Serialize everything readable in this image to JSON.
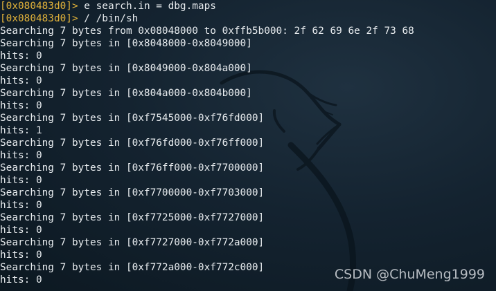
{
  "terminal": {
    "colors": {
      "background": "#142330",
      "text": "#e8ecef",
      "prompt": "#e2b33a"
    },
    "commands": [
      {
        "prompt": "[0x080483d0]>",
        "text": " e search.in = dbg.maps"
      },
      {
        "prompt": "[0x080483d0]>",
        "text": " / /bin/sh"
      }
    ],
    "output": [
      "Searching 7 bytes from 0x08048000 to 0xffb5b000: 2f 62 69 6e 2f 73 68",
      "Searching 7 bytes in [0x8048000-0x8049000]",
      "hits: 0",
      "Searching 7 bytes in [0x8049000-0x804a000]",
      "hits: 0",
      "Searching 7 bytes in [0x804a000-0x804b000]",
      "hits: 0",
      "Searching 7 bytes in [0xf7545000-0xf76fd000]",
      "hits: 1",
      "Searching 7 bytes in [0xf76fd000-0xf76ff000]",
      "hits: 0",
      "Searching 7 bytes in [0xf76ff000-0xf7700000]",
      "hits: 0",
      "Searching 7 bytes in [0xf7700000-0xf7703000]",
      "hits: 0",
      "Searching 7 bytes in [0xf7725000-0xf7727000]",
      "hits: 0",
      "Searching 7 bytes in [0xf7727000-0xf772a000]",
      "hits: 0",
      "Searching 7 bytes in [0xf772a000-0xf772c000]",
      "hits: 0"
    ]
  },
  "background_logo": "kali-dragon-icon",
  "watermark": "CSDN @ChuMeng1999"
}
